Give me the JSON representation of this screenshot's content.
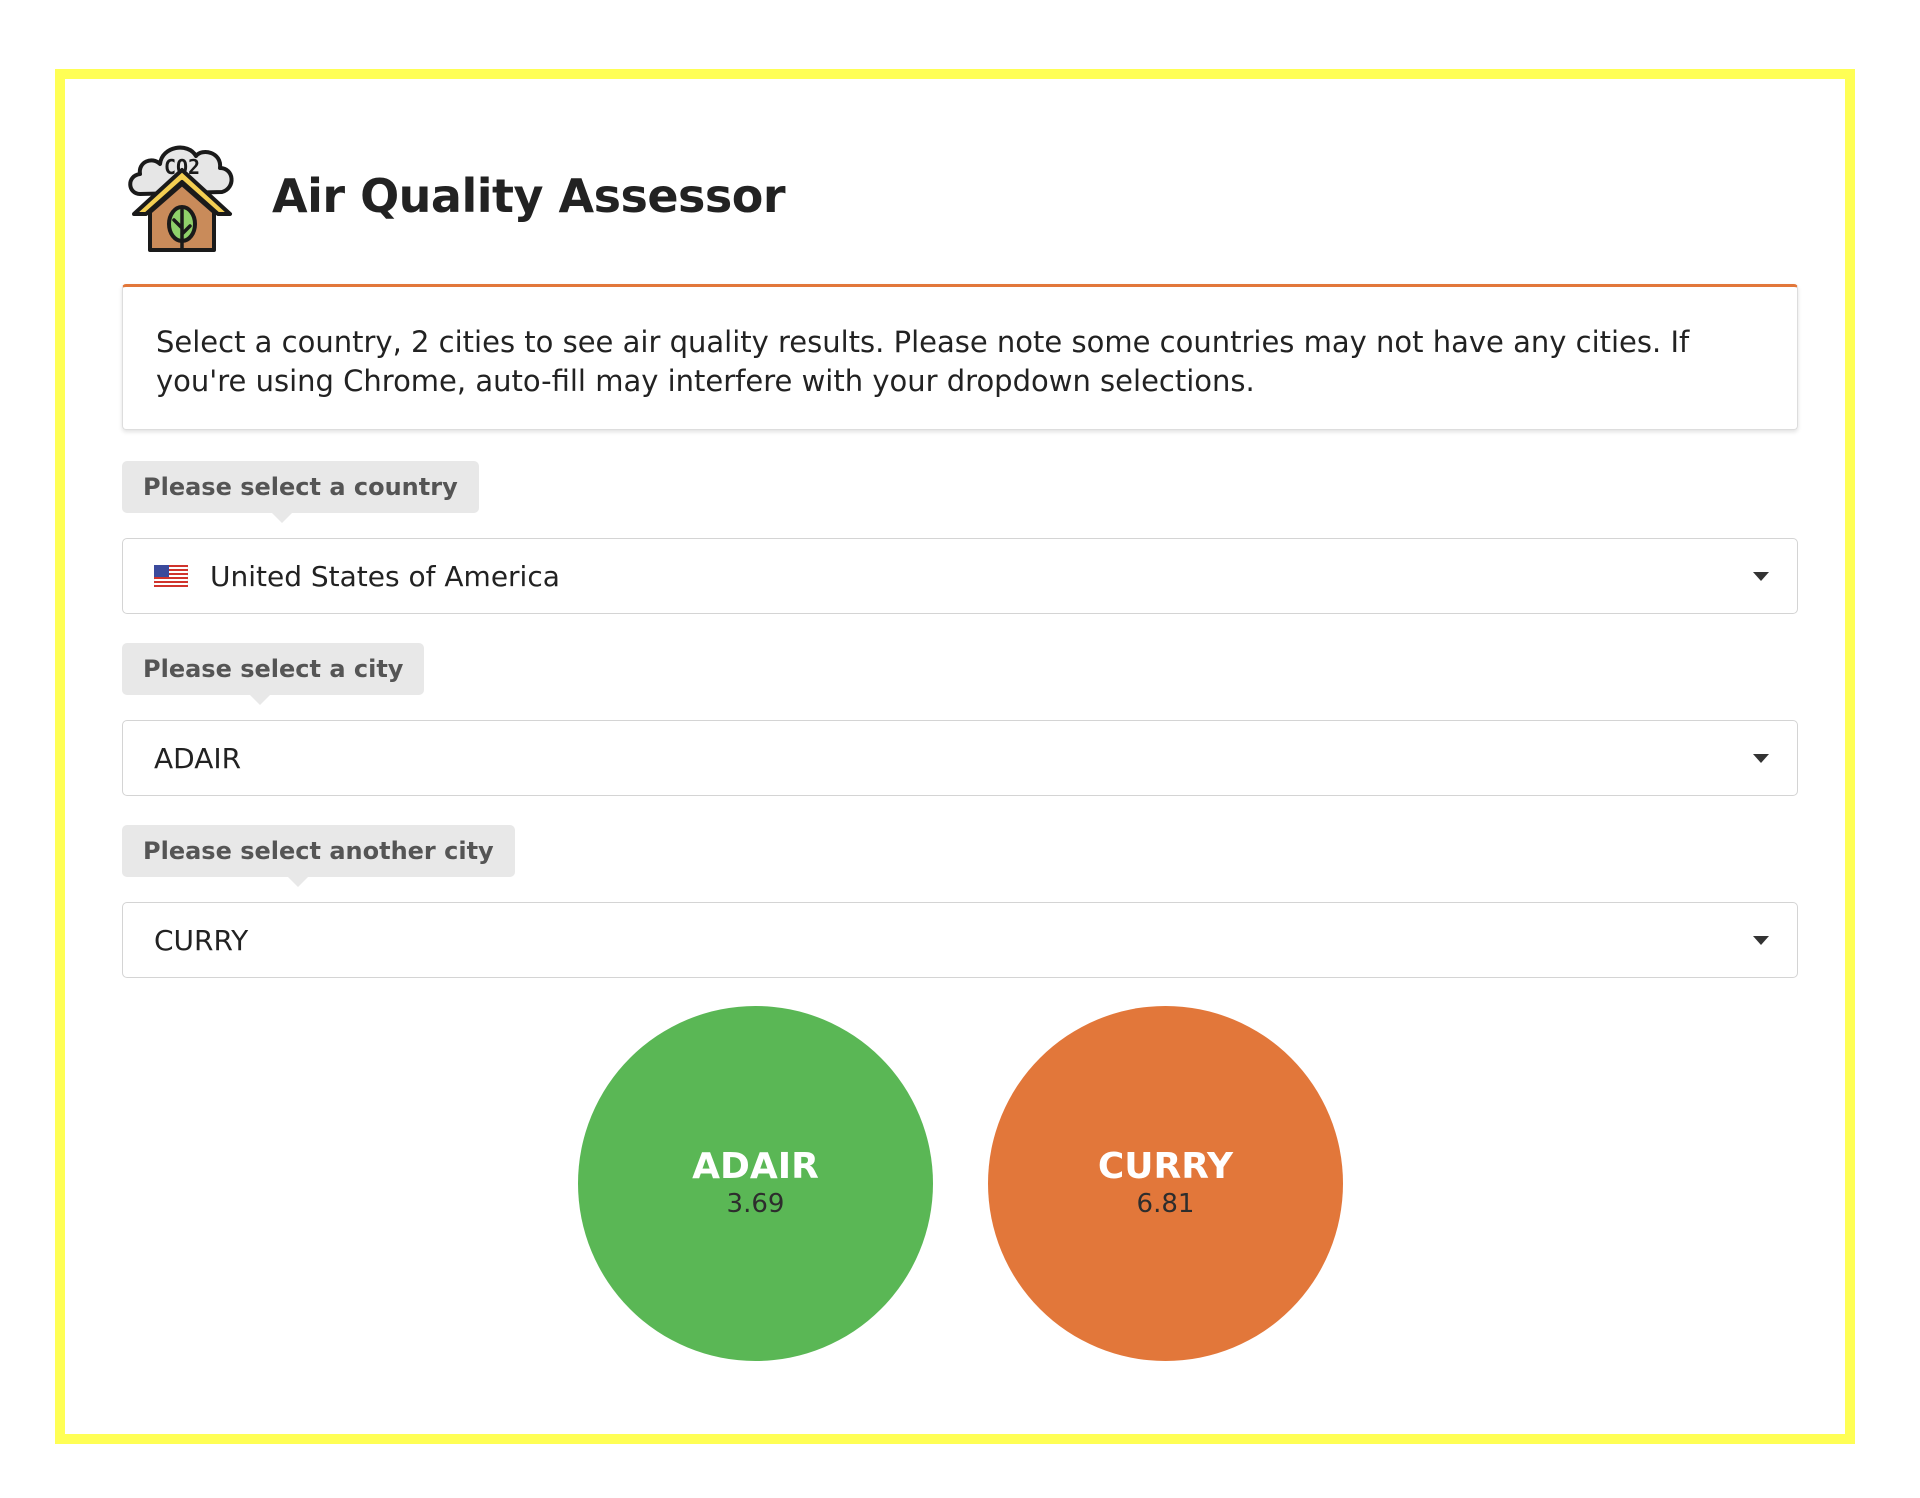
{
  "header": {
    "title": "Air Quality Assessor",
    "logo_icon": "co2-house-leaf-icon",
    "logo_text": "CO2"
  },
  "notice": {
    "text": "Select a country, 2 cities to see air quality results. Please note some countries may not have any cities. If you're using Chrome, auto-fill may interfere with your dropdown selections."
  },
  "country": {
    "label": "Please select a country",
    "value": "United States of America",
    "flag_icon": "us-flag-icon"
  },
  "city1": {
    "label": "Please select a city",
    "value": "ADAIR"
  },
  "city2": {
    "label": "Please select another city",
    "value": "CURRY"
  },
  "results": [
    {
      "city": "ADAIR",
      "value": "3.69",
      "color": "#5ab755"
    },
    {
      "city": "CURRY",
      "value": "6.81",
      "color": "#e2773a"
    }
  ],
  "colors": {
    "frame_border": "#ffff55",
    "notice_accent": "#e2773a",
    "label_bg": "#e8e8e8"
  }
}
